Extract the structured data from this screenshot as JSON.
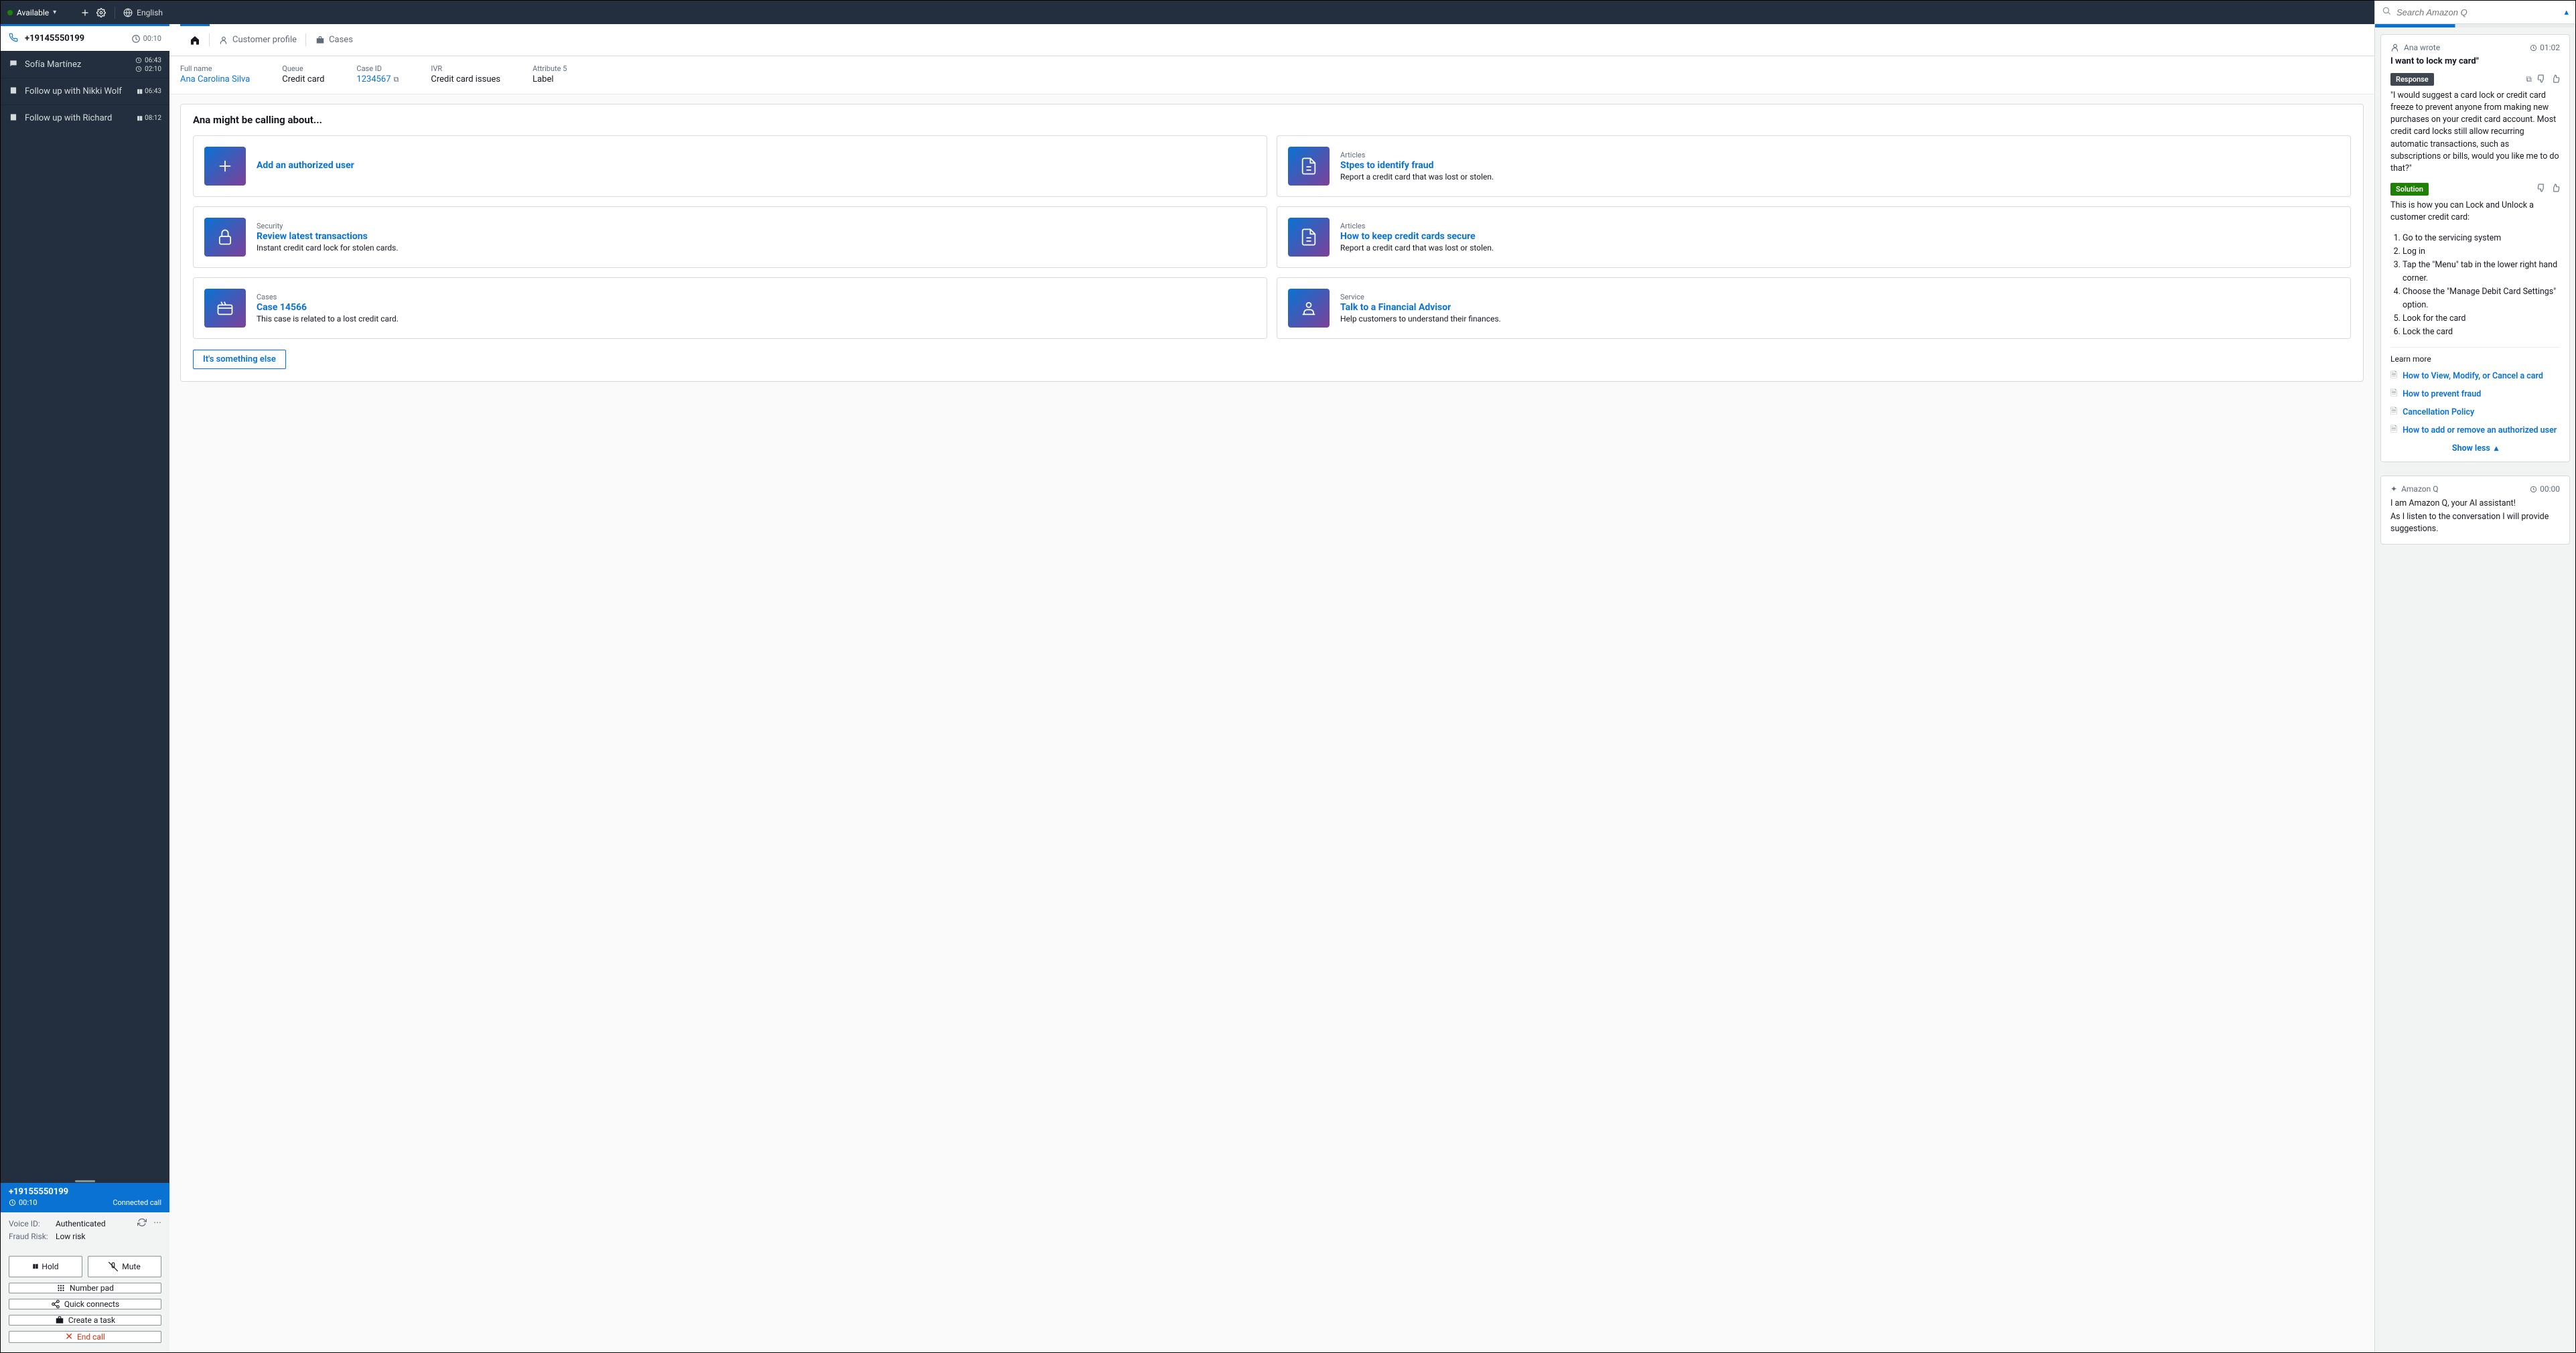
{
  "topbar": {
    "status": "Available",
    "language": "English"
  },
  "active_contact": {
    "number": "+19145550199",
    "timer": "00:10"
  },
  "sessions": [
    {
      "label": "Sofía Martínez",
      "type": "chat",
      "t1": "06:43",
      "t2": "02:10"
    },
    {
      "label": "Follow up with Nikki Wolf",
      "type": "task",
      "t1": "06:43"
    },
    {
      "label": "Follow up with Richard",
      "type": "task",
      "t1": "08:12"
    }
  ],
  "callinfo": {
    "number": "+19155550199",
    "timer": "00:10",
    "status": "Connected call"
  },
  "auth": {
    "voice_id_label": "Voice ID:",
    "voice_id_value": "Authenticated",
    "fraud_label": "Fraud Risk:",
    "fraud_value": "Low risk"
  },
  "controls": {
    "hold": "Hold",
    "mute": "Mute",
    "numpad": "Number pad",
    "quick": "Quick connects",
    "task": "Create a task",
    "end": "End call"
  },
  "tabs": {
    "customer_profile": "Customer profile",
    "cases": "Cases"
  },
  "meta": {
    "full_name_k": "Full name",
    "full_name_v": "Ana Carolina Silva",
    "queue_k": "Queue",
    "queue_v": "Credit card",
    "case_k": "Case ID",
    "case_v": "1234567",
    "ivr_k": "IVR",
    "ivr_v": "Credit card issues",
    "attr_k": "Attribute 5",
    "attr_v": "Label"
  },
  "suggest_title": "Ana might be calling about...",
  "cards": [
    {
      "cat": "",
      "title": "Add an authorized user",
      "desc": ""
    },
    {
      "cat": "Articles",
      "title": "Stpes to identify fraud",
      "desc": "Report a credit card that was lost or stolen."
    },
    {
      "cat": "Security",
      "title": "Review latest transactions",
      "desc": "Instant credit card lock for stolen cards."
    },
    {
      "cat": "Articles",
      "title": "How to keep credit cards secure",
      "desc": "Report a credit card that was lost or stolen."
    },
    {
      "cat": "Cases",
      "title": "Case 14566",
      "desc": "This case is related to a lost credit card."
    },
    {
      "cat": "Service",
      "title": "Talk to a Financial Advisor",
      "desc": "Help customers to understand their finances."
    }
  ],
  "else_btn": "It's something else",
  "q": {
    "search_placeholder": "Search Amazon Q",
    "who_wrote": "Ana wrote",
    "when1": "01:02",
    "quote": "I want to lock my card\"",
    "response_label": "Response",
    "response_body": "\"I would suggest a card lock or credit card freeze to prevent anyone from making new purchases on your credit card account. Most credit card locks still allow recurring automatic transactions, such as subscriptions or bills, would you like me to do that?\"",
    "solution_label": "Solution",
    "solution_intro": "This is how you can Lock and Unlock a customer credit card:",
    "steps": [
      "Go to the servicing system",
      "Log in",
      "Tap the \"Menu\" tab in the lower right hand corner.",
      "Choose the \"Manage Debit Card Settings\" option.",
      "Look for the card",
      "Lock the card"
    ],
    "learn_more": "Learn more",
    "links": [
      "How to View, Modify, or Cancel a card",
      "How to prevent fraud",
      "Cancellation Policy",
      "How to add or remove an authorized user"
    ],
    "show_less": "Show less",
    "assistant_name": "Amazon Q",
    "when2": "00:00",
    "assistant_body1": "I am Amazon Q, your AI assistant!",
    "assistant_body2": "As I listen to the conversation I will provide suggestions."
  }
}
